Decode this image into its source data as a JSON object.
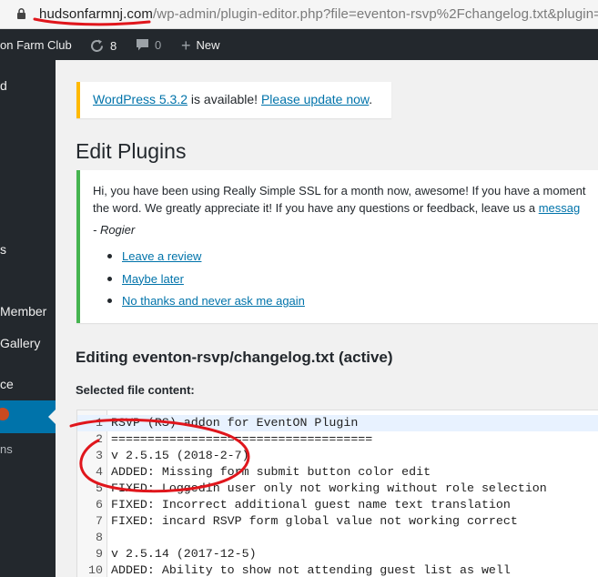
{
  "browser": {
    "url_host": "hudsonfarmnj.com",
    "url_path": "/wp-admin/plugin-editor.php?file=eventon-rsvp%2Fchangelog.txt&plugin="
  },
  "adminbar": {
    "site_name": "on Farm Club",
    "updates_count": "8",
    "comments_count": "0",
    "new_label": "New"
  },
  "sidebar": {
    "items": [
      {
        "label": "d"
      },
      {
        "label": "s"
      },
      {
        "label": "Member"
      },
      {
        "label": "Gallery"
      },
      {
        "label": "ce"
      },
      {
        "label": "ns"
      }
    ]
  },
  "update_notice": {
    "version_link": "WordPress 5.3.2",
    "middle_text": " is available! ",
    "update_link": "Please update now",
    "end_text": "."
  },
  "page_title": "Edit Plugins",
  "ssl_notice": {
    "line1": "Hi, you have been using Really Simple SSL for a month now, awesome! If you have a moment",
    "line2_prefix": "the word. We greatly appreciate it! If you have any questions or feedback, leave us a ",
    "line2_link": "messag",
    "signature": "- Rogier",
    "actions": [
      "Leave a review",
      "Maybe later",
      "No thanks and never ask me again"
    ]
  },
  "editing_title": "Editing eventon-rsvp/changelog.txt (active)",
  "selected_label": "Selected file content:",
  "editor": {
    "lines": [
      {
        "num": "1",
        "text": "RSVP (RS) addon for EventON Plugin"
      },
      {
        "num": "2",
        "text": "===================================="
      },
      {
        "num": "3",
        "text": "v 2.5.15 (2018-2-7)"
      },
      {
        "num": "4",
        "text": "ADDED: Missing form submit button color edit"
      },
      {
        "num": "5",
        "text": "FIXED: Loggedin user only not working without role selection"
      },
      {
        "num": "6",
        "text": "FIXED: Incorrect additional guest name text translation"
      },
      {
        "num": "7",
        "text": "FIXED: incard RSVP form global value not working correct"
      },
      {
        "num": "8",
        "text": ""
      },
      {
        "num": "9",
        "text": "v 2.5.14 (2017-12-5)"
      },
      {
        "num": "10",
        "text": "ADDED: Ability to show not attending guest list as well"
      }
    ]
  },
  "colors": {
    "admin_dark": "#23282d",
    "wp_blue": "#0073aa",
    "warning_yellow": "#ffb900",
    "success_green": "#46b450",
    "annotation_red": "#e0161c"
  }
}
